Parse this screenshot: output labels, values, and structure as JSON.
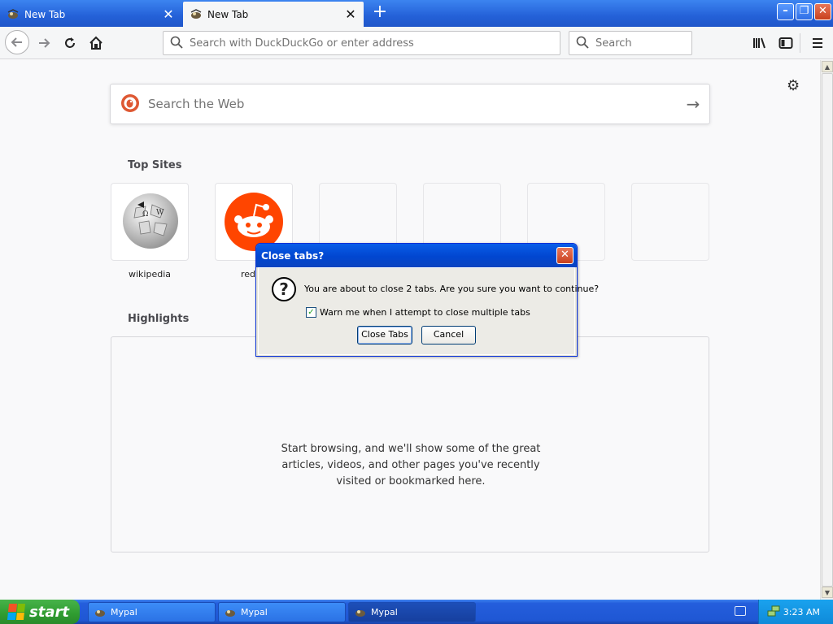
{
  "browser": {
    "tabs": [
      {
        "title": "New Tab",
        "active": false
      },
      {
        "title": "New Tab",
        "active": true
      }
    ],
    "urlbar": {
      "placeholder": "Search with DuckDuckGo or enter address"
    },
    "searchbar": {
      "placeholder": "Search"
    }
  },
  "newtab": {
    "web_search": {
      "placeholder": "Search the Web"
    },
    "top_sites": {
      "title": "Top Sites",
      "sites": [
        {
          "label": "wikipedia",
          "icon": "wikipedia-logo"
        },
        {
          "label": "redd",
          "icon": "reddit-logo"
        }
      ]
    },
    "highlights": {
      "title": "Highlights",
      "empty_message": "Start browsing, and we'll show some of the great articles, videos, and other pages you've recently visited or bookmarked here."
    }
  },
  "dialog": {
    "title": "Close tabs?",
    "message": "You are about to close 2 tabs. Are you sure you want to continue?",
    "checkbox_label": "Warn me when I attempt to close multiple tabs",
    "checkbox_checked": true,
    "primary_button": "Close Tabs",
    "secondary_button": "Cancel"
  },
  "taskbar": {
    "start_label": "start",
    "tasks": [
      {
        "label": "Mypal",
        "active": false
      },
      {
        "label": "Mypal",
        "active": false
      },
      {
        "label": "Mypal",
        "active": true
      }
    ],
    "clock": "3:23 AM"
  },
  "colors": {
    "titlebar_blue": "#2461d8",
    "dialog_title_blue": "#0146d0",
    "taskbar_blue": "#245edc",
    "start_green": "#2f9c30",
    "reddit_orange": "#ff4500",
    "duckduckgo_orange": "#de5833"
  }
}
